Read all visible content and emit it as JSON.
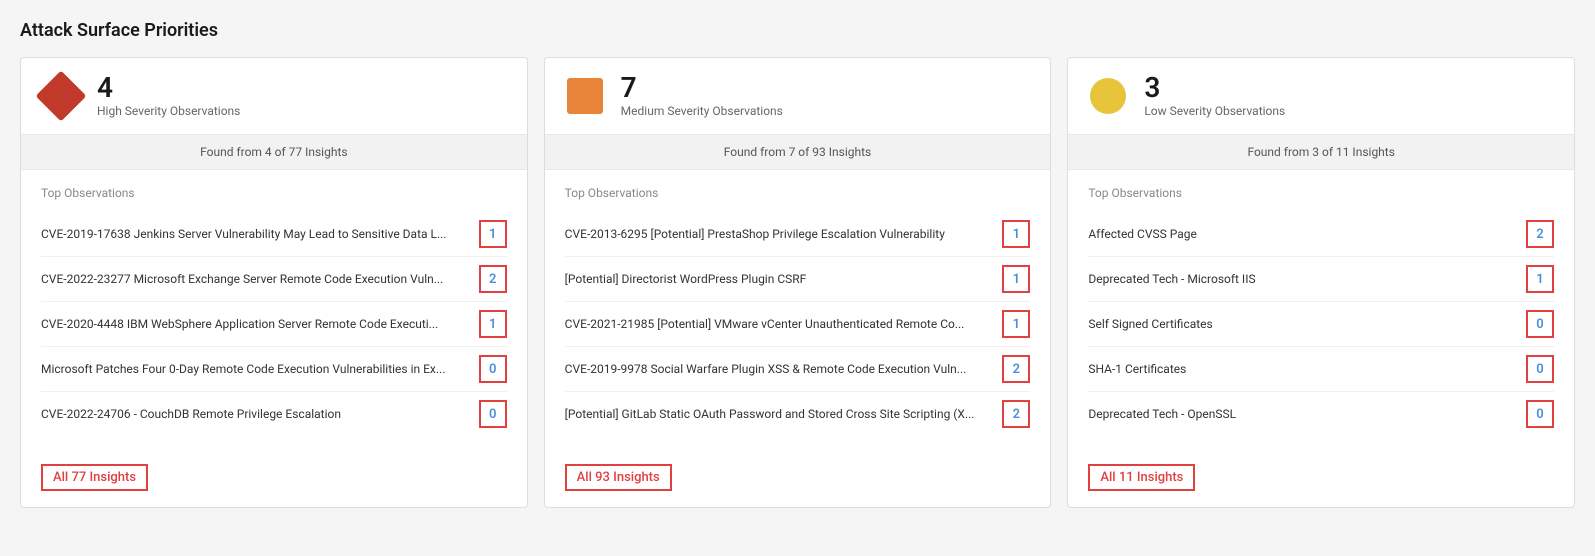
{
  "page": {
    "title": "Attack Surface Priorities"
  },
  "cards": [
    {
      "id": "high",
      "severity_shape": "diamond",
      "count": "4",
      "severity_label": "High Severity Observations",
      "subheader": "Found from 4 of 77 Insights",
      "top_observations_label": "Top Observations",
      "observations": [
        {
          "text": "CVE-2019-17638 Jenkins Server Vulnerability May Lead to Sensitive Data L...",
          "count": "1"
        },
        {
          "text": "CVE-2022-23277 Microsoft Exchange Server Remote Code Execution Vuln...",
          "count": "2"
        },
        {
          "text": "CVE-2020-4448 IBM WebSphere Application Server Remote Code Executi...",
          "count": "1"
        },
        {
          "text": "Microsoft Patches Four 0-Day Remote Code Execution Vulnerabilities in Ex...",
          "count": "0"
        },
        {
          "text": "CVE-2022-24706 - CouchDB Remote Privilege Escalation",
          "count": "0"
        }
      ],
      "insights_link_label": "All 77 Insights"
    },
    {
      "id": "medium",
      "severity_shape": "square",
      "count": "7",
      "severity_label": "Medium Severity Observations",
      "subheader": "Found from 7 of 93 Insights",
      "top_observations_label": "Top Observations",
      "observations": [
        {
          "text": "CVE-2013-6295 [Potential] PrestaShop Privilege Escalation Vulnerability",
          "count": "1"
        },
        {
          "text": "[Potential] Directorist WordPress Plugin CSRF",
          "count": "1"
        },
        {
          "text": "CVE-2021-21985 [Potential] VMware vCenter Unauthenticated Remote Co...",
          "count": "1"
        },
        {
          "text": "CVE-2019-9978 Social Warfare Plugin XSS & Remote Code Execution Vuln...",
          "count": "2"
        },
        {
          "text": "[Potential] GitLab Static OAuth Password and Stored Cross Site Scripting (X...",
          "count": "2"
        }
      ],
      "insights_link_label": "All 93 Insights"
    },
    {
      "id": "low",
      "severity_shape": "circle",
      "count": "3",
      "severity_label": "Low Severity Observations",
      "subheader": "Found from 3 of 11 Insights",
      "top_observations_label": "Top Observations",
      "observations": [
        {
          "text": "Affected CVSS Page",
          "count": "2"
        },
        {
          "text": "Deprecated Tech - Microsoft IIS",
          "count": "1"
        },
        {
          "text": "Self Signed Certificates",
          "count": "0"
        },
        {
          "text": "SHA-1 Certificates",
          "count": "0"
        },
        {
          "text": "Deprecated Tech - OpenSSL",
          "count": "0"
        }
      ],
      "insights_link_label": "All 11 Insights"
    }
  ]
}
